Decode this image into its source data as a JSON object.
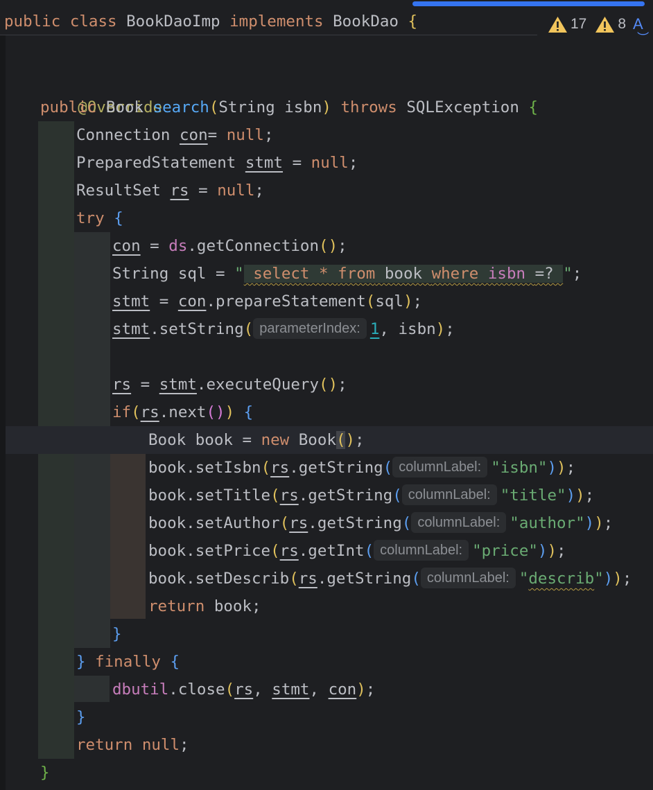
{
  "sticky_header": {
    "kw_public": "public",
    "kw_class": "class",
    "class_name": "BookDaoImp",
    "kw_implements": "implements",
    "interface_name": "BookDao",
    "brace": "{"
  },
  "inspections": {
    "warnings_count": "17",
    "weak_warnings_count": "8",
    "colors": {
      "warning": "#f2c55c",
      "accent": "#3574f0"
    }
  },
  "code": {
    "l0_annotation": "@Override",
    "l1": {
      "kw_public": "public",
      "type": "Book",
      "name": "search",
      "open": "(",
      "params": "String isbn",
      "close": ")",
      "kw_throws": "throws",
      "exception": "SQLException",
      "brace": "{"
    },
    "l2": {
      "type": "Connection",
      "var": "con",
      "rest": "= ",
      "kw_null": "null",
      "semi": ";"
    },
    "l3": {
      "type": "PreparedStatement",
      "var": "stmt",
      "rest": " = ",
      "kw_null": "null",
      "semi": ";"
    },
    "l4": {
      "type": "ResultSet",
      "var": "rs",
      "rest": " = ",
      "kw_null": "null",
      "semi": ";"
    },
    "l5": {
      "kw_try": "try",
      "brace": "{"
    },
    "l6": {
      "var": "con",
      "eq": " = ",
      "field": "ds",
      "call": ".getConnection",
      "parens": "()",
      "semi": ";"
    },
    "l7": {
      "decl": "String sql = ",
      "quote_open": "\"",
      "sql_select": "select",
      "sql_star": " * ",
      "sql_from": "from",
      "sql_table": " book ",
      "sql_where": "where",
      "sql_col": " isbn ",
      "sql_cond": "=? ",
      "quote_close": "\"",
      "semi": ";"
    },
    "l8": {
      "var": "stmt",
      "eq": " = ",
      "var2": "con",
      "call": ".prepareStatement",
      "open": "(",
      "arg": "sql",
      "close": ")",
      "semi": ";"
    },
    "l9": {
      "var": "stmt",
      "call": ".setString",
      "open": "(",
      "hint": "parameterIndex:",
      "num": "1",
      "rest": ", isbn",
      "close": ")",
      "semi": ";"
    },
    "l11": {
      "var": "rs",
      "eq": " = ",
      "var2": "stmt",
      "call": ".executeQuery",
      "parens": "()",
      "semi": ";"
    },
    "l12": {
      "kw_if": "if",
      "open": "(",
      "var": "rs",
      "call": ".next",
      "parens": "()",
      "close": ")",
      "brace": "{"
    },
    "l13": {
      "decl": "Book book = ",
      "kw_new": "new",
      "type": " Book",
      "open": "(",
      "close": ")",
      "semi": ";"
    },
    "l14": {
      "call": "book.setIsbn",
      "var": "rs",
      "inner": ".getString",
      "hint": "columnLabel:",
      "str": "\"isbn\""
    },
    "l15": {
      "call": "book.setTitle",
      "var": "rs",
      "inner": ".getString",
      "hint": "columnLabel:",
      "str": "\"title\""
    },
    "l16": {
      "call": "book.setAuthor",
      "var": "rs",
      "inner": ".getString",
      "hint": "columnLabel:",
      "str": "\"author\""
    },
    "l17": {
      "call": "book.setPrice",
      "var": "rs",
      "inner": ".getInt",
      "hint": "columnLabel:",
      "str": "\"price\""
    },
    "l18": {
      "call": "book.setDescrib",
      "var": "rs",
      "inner": ".getString",
      "hint": "columnLabel:",
      "str_open": "\"",
      "str_word": "describ",
      "str_close": "\""
    },
    "l19": {
      "kw_return": "return",
      "rest": " book;"
    },
    "l20": {
      "brace": "}"
    },
    "l21": {
      "brace": "}",
      "kw_finally": "finally",
      "brace2": "{"
    },
    "l22": {
      "field": "dbutil",
      "call": ".close",
      "open": "(",
      "v1": "rs",
      "sep1": ", ",
      "v2": "stmt",
      "sep2": ", ",
      "v3": "con",
      "close": ")",
      "semi": ";"
    },
    "l23": {
      "brace": "}"
    },
    "l24": {
      "kw_return": "return",
      "kw_null": "null",
      "semi": ";"
    },
    "l25": {
      "brace": "}"
    },
    "punct": {
      "space": " ",
      "dot": ".",
      "open": "(",
      "close": ")",
      "close_close_semi": "));"
    }
  }
}
